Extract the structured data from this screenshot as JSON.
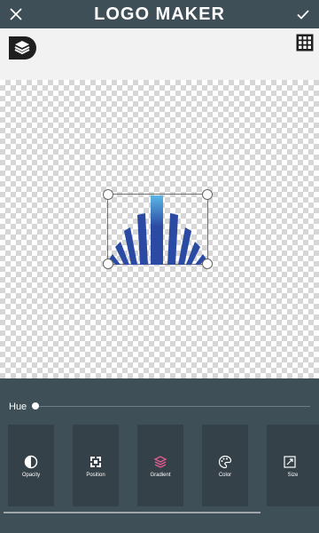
{
  "header": {
    "title": "LOGO MAKER"
  },
  "panel": {
    "hue_label": "Hue",
    "hue_value_percent": 0
  },
  "tools": [
    {
      "label": "Opacity",
      "icon": "opacity-icon"
    },
    {
      "label": "Position",
      "icon": "position-icon"
    },
    {
      "label": "Gradient",
      "icon": "gradient-icon"
    },
    {
      "label": "Color",
      "icon": "palette-icon"
    },
    {
      "label": "Size",
      "icon": "size-icon"
    }
  ],
  "colors": {
    "header_bg": "#3e4f57",
    "panel_bg": "#3e4f57",
    "tool_bg": "#344148",
    "logo_blue": "#2b4aa3",
    "logo_light": "#5bb7e6",
    "gradient_icon": "#e35b8f"
  }
}
